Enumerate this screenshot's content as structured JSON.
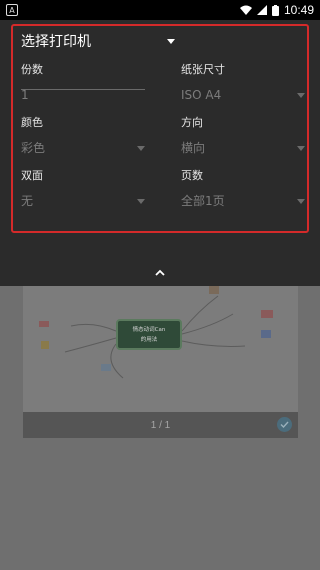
{
  "status": {
    "time": "10:49",
    "notification_glyph": "A"
  },
  "print_options": {
    "printer": "选择打印机",
    "copies": {
      "label": "份数",
      "value": "1"
    },
    "paper_size": {
      "label": "纸张尺寸",
      "value": "ISO A4"
    },
    "color": {
      "label": "颜色",
      "value": "彩色"
    },
    "orientation": {
      "label": "方向",
      "value": "横向"
    },
    "duplex": {
      "label": "双面",
      "value": "无"
    },
    "pages": {
      "label": "页数",
      "value": "全部1页"
    }
  },
  "preview": {
    "mindmap_title_line1": "情态动词Can",
    "mindmap_title_line2": "的用法",
    "page_indicator": "1 / 1"
  },
  "colors": {
    "highlight_border": "#d42a2a",
    "panel_bg": "#2b2b2b",
    "preview_bg": "#6f6f6f"
  }
}
